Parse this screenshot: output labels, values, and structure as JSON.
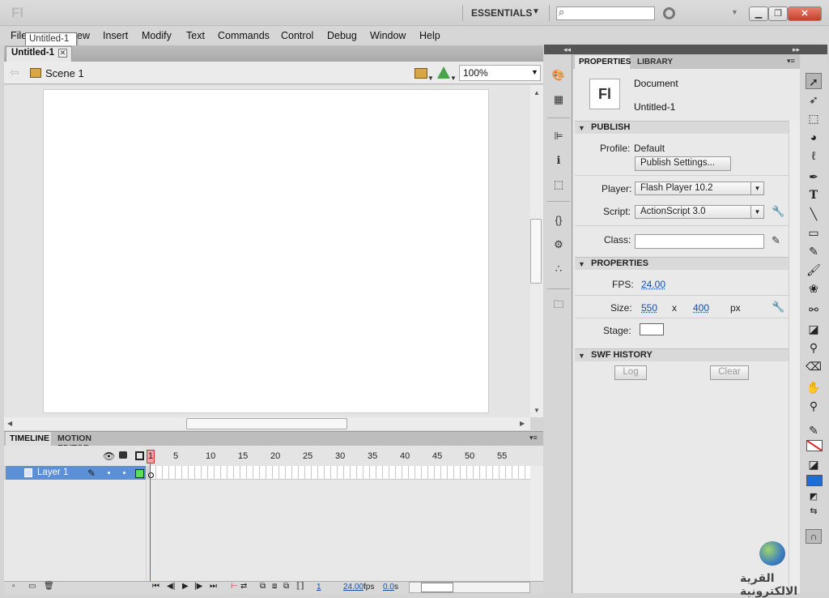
{
  "app": {
    "logo": "Fl"
  },
  "titlebar": {
    "workspace": "ESSENTIALS",
    "search_placeholder": ""
  },
  "menu": [
    "File",
    "Edit",
    "View",
    "Insert",
    "Modify",
    "Text",
    "Commands",
    "Control",
    "Debug",
    "Window",
    "Help"
  ],
  "tooltip": "Untitled-1",
  "document": {
    "tab": "Untitled-1",
    "scene": "Scene 1",
    "zoom": "100%"
  },
  "timeline": {
    "tabs": [
      "TIMELINE",
      "MOTION EDITOR"
    ],
    "frame_numbers": [
      "1",
      "5",
      "10",
      "15",
      "20",
      "25",
      "30",
      "35",
      "40",
      "45",
      "50",
      "55"
    ],
    "layer": "Layer 1",
    "current_frame": "1",
    "fps": "24.00",
    "fps_unit": "fps",
    "time": "0.0",
    "time_unit": "s"
  },
  "properties": {
    "tabs": [
      "PROPERTIES",
      "LIBRARY"
    ],
    "doc_icon": "Fl",
    "doc_type": "Document",
    "doc_name": "Untitled-1",
    "publish": {
      "header": "PUBLISH",
      "profile_label": "Profile:",
      "profile_value": "Default",
      "settings_button": "Publish Settings...",
      "player_label": "Player:",
      "player_value": "Flash Player 10.2",
      "script_label": "Script:",
      "script_value": "ActionScript 3.0",
      "class_label": "Class:"
    },
    "props": {
      "header": "PROPERTIES",
      "fps_label": "FPS:",
      "fps_value": "24.00",
      "size_label": "Size:",
      "width": "550",
      "x": "x",
      "height": "400",
      "unit": "px",
      "stage_label": "Stage:",
      "stage_color": "#ffffff"
    },
    "swf": {
      "header": "SWF HISTORY",
      "log": "Log",
      "clear": "Clear"
    }
  },
  "colors": {
    "stroke": "#dd2222",
    "fill": "#1a6ed8",
    "layer_color": "#5bdc5b"
  },
  "watermark": "القرية الالكترونية"
}
